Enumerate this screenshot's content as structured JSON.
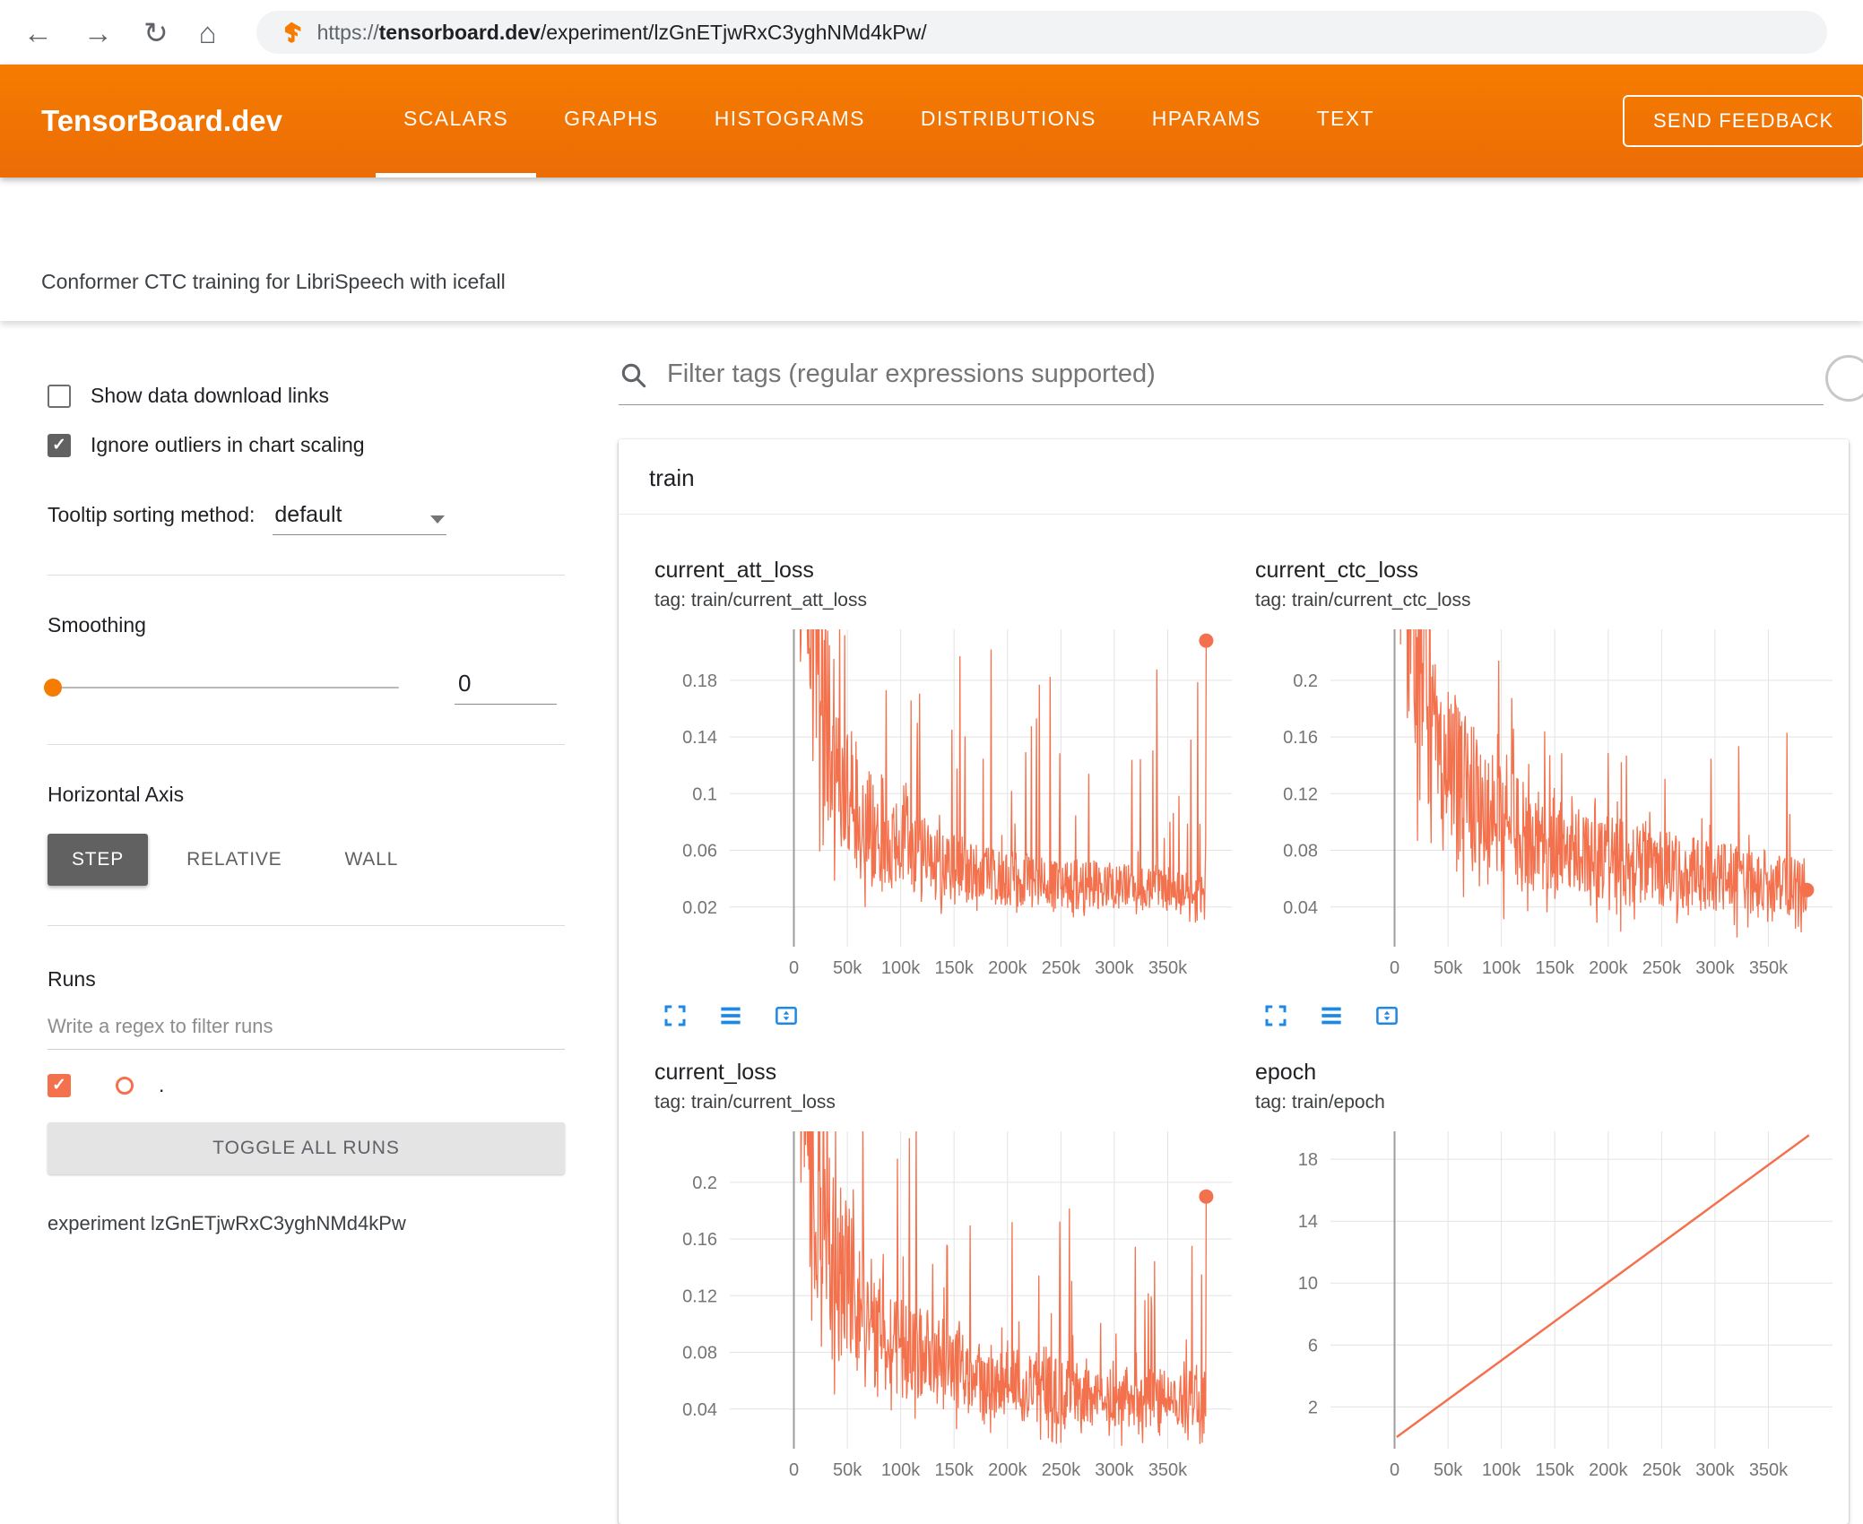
{
  "browser": {
    "url_scheme": "https://",
    "url_domain": "tensorboard.dev",
    "url_path": "/experiment/lzGnETjwRxC3yghNMd4kPw/"
  },
  "icons": {
    "back": "←",
    "forward": "→",
    "reload": "↻",
    "home": "⌂"
  },
  "header": {
    "logo": "TensorBoard.dev",
    "tabs": [
      "SCALARS",
      "GRAPHS",
      "HISTOGRAMS",
      "DISTRIBUTIONS",
      "HPARAMS",
      "TEXT"
    ],
    "active_tab": "SCALARS",
    "feedback": "SEND FEEDBACK"
  },
  "experiment_title": "Conformer CTC training for LibriSpeech with icefall",
  "sidebar": {
    "show_download_label": "Show data download links",
    "show_download_checked": false,
    "ignore_outliers_label": "Ignore outliers in chart scaling",
    "ignore_outliers_checked": true,
    "tooltip_label": "Tooltip sorting method:",
    "tooltip_value": "default",
    "smoothing_label": "Smoothing",
    "smoothing_value": "0",
    "axis_label": "Horizontal Axis",
    "axis_options": [
      "STEP",
      "RELATIVE",
      "WALL"
    ],
    "axis_selected": "STEP",
    "runs_label": "Runs",
    "runs_filter_placeholder": "Write a regex to filter runs",
    "run_name": ".",
    "run_checked": true,
    "toggle_all_label": "TOGGLE ALL RUNS",
    "experiment_label": "experiment lzGnETjwRxC3yghNMd4kPw"
  },
  "main": {
    "filter_placeholder": "Filter tags (regular expressions supported)",
    "section_title": "train"
  },
  "colors": {
    "header_orange": "#f57c00",
    "accent_orange": "#f57c00",
    "run_color": "#f4714d",
    "icon_blue": "#1e88e5"
  },
  "chart_data": [
    {
      "type": "line",
      "title": "current_att_loss",
      "subtitle": "tag: train/current_att_loss",
      "xlim": [
        -60000,
        410000
      ],
      "ylim": [
        -0.008,
        0.216
      ],
      "x_ticks": [
        0,
        50000,
        100000,
        150000,
        200000,
        250000,
        300000,
        350000
      ],
      "x_tick_labels": [
        "0",
        "50k",
        "100k",
        "150k",
        "200k",
        "250k",
        "300k",
        "350k"
      ],
      "y_ticks": [
        0.02,
        0.06,
        0.1,
        0.14,
        0.18
      ],
      "y_tick_labels": [
        "0.02",
        "0.06",
        "0.1",
        "0.14",
        "0.18"
      ],
      "grid": true,
      "legend": "none",
      "end_marker": true,
      "series": {
        "name": ".",
        "color": "#f4714d",
        "width": 1.3,
        "gen": {
          "seed": 11,
          "n": 720,
          "x_start": 4000,
          "x_end": 386000,
          "trend": [
            [
              4000,
              0.3
            ],
            [
              15000,
              0.22
            ],
            [
              30000,
              0.15
            ],
            [
              60000,
              0.09
            ],
            [
              100000,
              0.062
            ],
            [
              150000,
              0.048
            ],
            [
              200000,
              0.04
            ],
            [
              260000,
              0.036
            ],
            [
              320000,
              0.034
            ],
            [
              386000,
              0.032
            ]
          ],
          "jitter": 0.5,
          "spike_prob": 0.12,
          "spike_max": 0.16,
          "spike_pow": 2.4,
          "dip_prob": 0.12,
          "last": 0.208
        }
      }
    },
    {
      "type": "line",
      "title": "current_ctc_loss",
      "subtitle": "tag: train/current_ctc_loss",
      "xlim": [
        -60000,
        410000
      ],
      "ylim": [
        0.012,
        0.236
      ],
      "x_ticks": [
        0,
        50000,
        100000,
        150000,
        200000,
        250000,
        300000,
        350000
      ],
      "x_tick_labels": [
        "0",
        "50k",
        "100k",
        "150k",
        "200k",
        "250k",
        "300k",
        "350k"
      ],
      "y_ticks": [
        0.04,
        0.08,
        0.12,
        0.16,
        0.2
      ],
      "y_tick_labels": [
        "0.04",
        "0.08",
        "0.12",
        "0.16",
        "0.2"
      ],
      "grid": true,
      "legend": "none",
      "end_marker": true,
      "series": {
        "name": ".",
        "color": "#f4714d",
        "width": 1.3,
        "gen": {
          "seed": 23,
          "n": 720,
          "x_start": 4000,
          "x_end": 386000,
          "trend": [
            [
              4000,
              0.35
            ],
            [
              15000,
              0.26
            ],
            [
              30000,
              0.19
            ],
            [
              60000,
              0.13
            ],
            [
              100000,
              0.1
            ],
            [
              150000,
              0.085
            ],
            [
              200000,
              0.075
            ],
            [
              260000,
              0.066
            ],
            [
              320000,
              0.06
            ],
            [
              386000,
              0.053
            ]
          ],
          "jitter": 0.4,
          "spike_prob": 0.1,
          "spike_max": 0.1,
          "spike_pow": 2.2,
          "dip_prob": 0.1,
          "last": 0.052
        }
      }
    },
    {
      "type": "line",
      "title": "current_loss",
      "subtitle": "tag: train/current_loss",
      "xlim": [
        -60000,
        410000
      ],
      "ylim": [
        0.012,
        0.236
      ],
      "x_ticks": [
        0,
        50000,
        100000,
        150000,
        200000,
        250000,
        300000,
        350000
      ],
      "x_tick_labels": [
        "0",
        "50k",
        "100k",
        "150k",
        "200k",
        "250k",
        "300k",
        "350k"
      ],
      "y_ticks": [
        0.04,
        0.08,
        0.12,
        0.16,
        0.2
      ],
      "y_tick_labels": [
        "0.04",
        "0.08",
        "0.12",
        "0.16",
        "0.2"
      ],
      "grid": true,
      "legend": "none",
      "end_marker": true,
      "series": {
        "name": ".",
        "color": "#f4714d",
        "width": 1.3,
        "gen": {
          "seed": 37,
          "n": 720,
          "x_start": 4000,
          "x_end": 386000,
          "trend": [
            [
              4000,
              0.33
            ],
            [
              15000,
              0.24
            ],
            [
              30000,
              0.17
            ],
            [
              60000,
              0.11
            ],
            [
              100000,
              0.085
            ],
            [
              150000,
              0.068
            ],
            [
              200000,
              0.058
            ],
            [
              260000,
              0.052
            ],
            [
              320000,
              0.048
            ],
            [
              386000,
              0.046
            ]
          ],
          "jitter": 0.45,
          "spike_prob": 0.11,
          "spike_max": 0.13,
          "spike_pow": 2.3,
          "dip_prob": 0.12,
          "last": 0.19
        }
      }
    },
    {
      "type": "line",
      "title": "epoch",
      "subtitle": "tag: train/epoch",
      "xlim": [
        -60000,
        410000
      ],
      "ylim": [
        -0.7,
        19.8
      ],
      "x_ticks": [
        0,
        50000,
        100000,
        150000,
        200000,
        250000,
        300000,
        350000
      ],
      "x_tick_labels": [
        "0",
        "50k",
        "100k",
        "150k",
        "200k",
        "250k",
        "300k",
        "350k"
      ],
      "y_ticks": [
        2,
        6,
        10,
        14,
        18
      ],
      "y_tick_labels": [
        "2",
        "6",
        "10",
        "14",
        "18"
      ],
      "grid": true,
      "legend": "none",
      "end_marker": false,
      "series": {
        "name": ".",
        "color": "#f4714d",
        "width": 2.5,
        "points": [
          [
            2000,
            0.05
          ],
          [
            388000,
            19.55
          ]
        ]
      }
    }
  ]
}
